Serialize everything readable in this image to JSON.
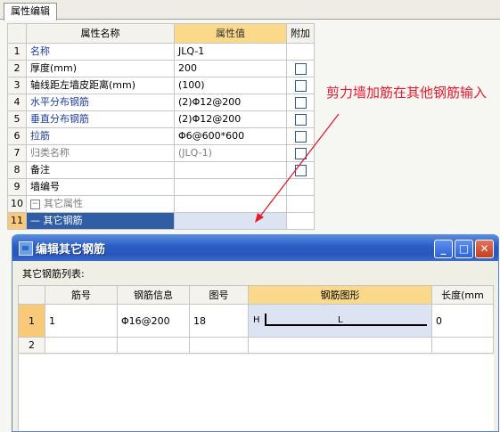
{
  "tab": {
    "label": "属性编辑"
  },
  "grid": {
    "headers": {
      "name": "属性名称",
      "value": "属性值",
      "extra": "附加"
    },
    "rows": [
      {
        "idx": "1",
        "name": "名称",
        "value": "JLQ-1",
        "checkbox": false
      },
      {
        "idx": "2",
        "name": "厚度(mm)",
        "value": "200",
        "checkbox": true
      },
      {
        "idx": "3",
        "name": "轴线距左墙皮距离(mm)",
        "value": "(100)",
        "checkbox": true
      },
      {
        "idx": "4",
        "name": "水平分布钢筋",
        "value": "(2)Φ12@200",
        "checkbox": true
      },
      {
        "idx": "5",
        "name": "垂直分布钢筋",
        "value": "(2)Φ12@200",
        "checkbox": true
      },
      {
        "idx": "6",
        "name": "拉筋",
        "value": "Φ6@600*600",
        "checkbox": true
      },
      {
        "idx": "7",
        "name": "归类名称",
        "value": "(JLQ-1)",
        "checkbox": true
      },
      {
        "idx": "8",
        "name": "备注",
        "value": "",
        "checkbox": true
      },
      {
        "idx": "9",
        "name": "墙编号",
        "value": "",
        "checkbox": false
      },
      {
        "idx": "10",
        "name": "其它属性",
        "value": "",
        "checkbox": false
      },
      {
        "idx": "11",
        "name": "其它钢筋",
        "value": "",
        "checkbox": false
      }
    ]
  },
  "annotation": {
    "text": "剪力墙加筋在其他钢筋输入"
  },
  "dialog": {
    "title": "编辑其它钢筋",
    "list_label": "其它钢筋列表:",
    "window_buttons": {
      "minimize": "_",
      "maximize": "□",
      "close": "✕"
    },
    "headers": {
      "bar_no": "筋号",
      "bar_info": "钢筋信息",
      "fig_no": "图号",
      "bar_shape": "钢筋图形",
      "length": "长度(mm"
    },
    "rows": [
      {
        "idx": "1",
        "bar_no": "1",
        "bar_info": "Φ16@200",
        "fig_no": "18",
        "shape_h": "H",
        "shape_l": "L",
        "length": "0"
      },
      {
        "idx": "2",
        "bar_no": "",
        "bar_info": "",
        "fig_no": "",
        "shape_h": "",
        "shape_l": "",
        "length": ""
      }
    ]
  },
  "colors": {
    "accent": "#2f5ea6",
    "header_highlight": "#fbd98a",
    "annotation": "#e8192c",
    "titlebar": "#2b5dc3"
  }
}
